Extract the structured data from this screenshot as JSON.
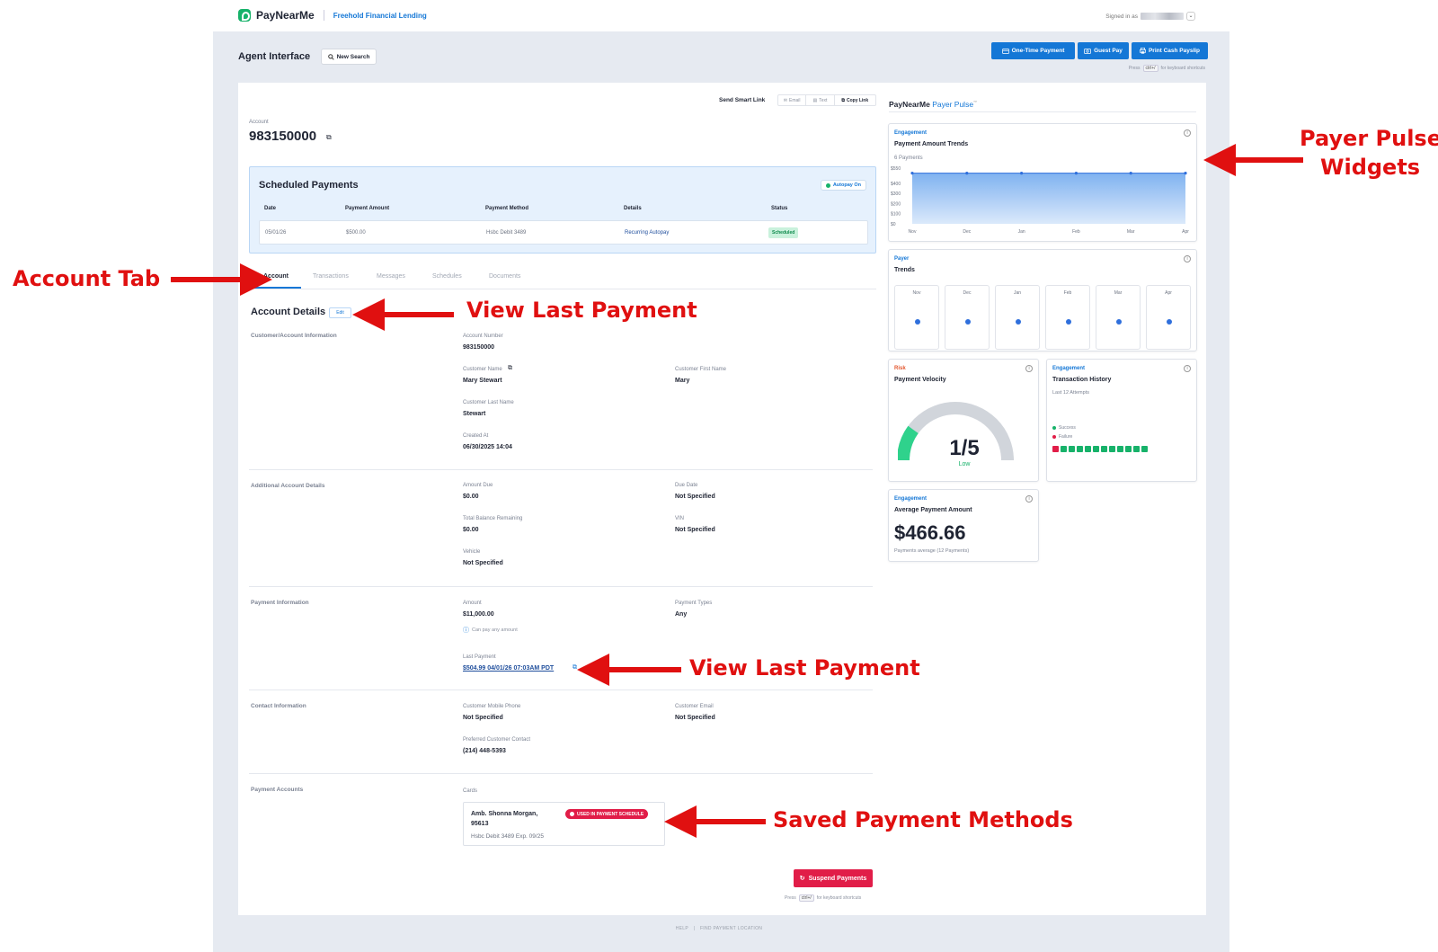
{
  "header": {
    "brand": "PayNearMe",
    "lender": "Freehold Financial Lending",
    "signed_in": "Signed in as"
  },
  "toolbar": {
    "title": "Agent Interface",
    "new_search": "New Search",
    "one_time_payment": "One-Time Payment",
    "guest_pay": "Guest Pay",
    "print_cash_payslip": "Print Cash Payslip",
    "kb_press": "Press",
    "kb_key": "ctrl+/",
    "kb_suffix": "for keyboard shortcuts"
  },
  "smart_link": {
    "label": "Send Smart Link",
    "email": "Email",
    "text": "Text",
    "copy": "Copy Link"
  },
  "account": {
    "label": "Account",
    "number": "983150000"
  },
  "scheduled": {
    "title": "Scheduled Payments",
    "autopay": "Autopay On",
    "headers": [
      "Date",
      "Payment Amount",
      "Payment Method",
      "Details",
      "Status"
    ],
    "row": {
      "date": "05/01/26",
      "amount": "$500.00",
      "method": "Hsbc Debit 3489",
      "details": "Recurring Autopay",
      "status": "Scheduled"
    }
  },
  "tabs": [
    "Account",
    "Transactions",
    "Messages",
    "Schedules",
    "Documents"
  ],
  "details": {
    "title": "Account Details",
    "edit": "Edit",
    "sections": {
      "customer": "Customer/Account Information",
      "additional": "Additional Account Details",
      "payment": "Payment Information",
      "contact": "Contact Information",
      "accounts": "Payment Accounts"
    },
    "account_number_label": "Account Number",
    "account_number": "983150000",
    "customer_name_label": "Customer Name",
    "customer_name": "Mary Stewart",
    "first_name_label": "Customer First Name",
    "first_name": "Mary",
    "last_name_label": "Customer Last Name",
    "last_name": "Stewart",
    "created_label": "Created At",
    "created": "06/30/2025 14:04",
    "amount_due_label": "Amount Due",
    "amount_due": "$0.00",
    "due_date_label": "Due Date",
    "due_date": "Not Specified",
    "balance_label": "Total Balance Remaining",
    "balance": "$0.00",
    "vin_label": "VIN",
    "vin": "Not Specified",
    "vehicle_label": "Vehicle",
    "vehicle": "Not Specified",
    "amount_label": "Amount",
    "amount": "$11,000.00",
    "any_amount": "Can pay any amount",
    "payment_types_label": "Payment Types",
    "payment_types": "Any",
    "last_payment_label": "Last Payment",
    "last_payment": "$504.99 04/01/26 07:03AM PDT",
    "mobile_label": "Customer Mobile Phone",
    "mobile": "Not Specified",
    "email_label": "Customer Email",
    "email": "Not Specified",
    "preferred_label": "Preferred Customer Contact",
    "preferred": "(214) 448-5393",
    "cards_label": "Cards",
    "card_name": "Amb. Shonna Morgan,",
    "card_zip": "95613",
    "card_meta": "Hsbc Debit 3489 Exp. 09/25",
    "card_badge": "USED IN PAYMENT SCHEDULE"
  },
  "suspend": "Suspend Payments",
  "pulse": {
    "brand": "PayNearMe",
    "product": "Payer Pulse",
    "tm": "™",
    "amount_trends": {
      "category": "Engagement",
      "title": "Payment Amount Trends",
      "subtitle": "6 Payments"
    },
    "payer_trends": {
      "category": "Payer",
      "title": "Trends",
      "months": [
        "Nov",
        "Dec",
        "Jan",
        "Feb",
        "Mar",
        "Apr"
      ]
    },
    "velocity": {
      "category": "Risk",
      "title": "Payment Velocity",
      "score": "1/5",
      "level": "Low",
      "fraction": 0.2
    },
    "history": {
      "category": "Engagement",
      "title": "Transaction History",
      "subtitle": "Last 12 Attempts",
      "success": "Success",
      "failure": "Failure",
      "attempts": [
        "failure",
        "success",
        "success",
        "success",
        "success",
        "success",
        "success",
        "success",
        "success",
        "success",
        "success",
        "success"
      ]
    },
    "average": {
      "category": "Engagement",
      "title": "Average Payment Amount",
      "value": "$466.66",
      "note": "Payments average (12 Payments)"
    }
  },
  "colors": {
    "brand_blue": "#1477d6",
    "danger": "#e11d48",
    "success": "#17b26a",
    "annotation": "#e01010"
  },
  "chart_data": {
    "type": "area",
    "categories": [
      "Nov",
      "Dec",
      "Jan",
      "Feb",
      "Mar",
      "Apr"
    ],
    "values": [
      500,
      500,
      500,
      500,
      500,
      500
    ],
    "ylim": [
      0,
      550
    ],
    "yticks": [
      "$550",
      "$400",
      "$300",
      "$200",
      "$100",
      "$0"
    ],
    "xlabel": "",
    "ylabel": ""
  },
  "annotations": {
    "account_tab": "Account Tab",
    "view_last_payment_1": "View Last Payment",
    "view_last_payment_2": "View Last Payment",
    "payer_pulse_1": "Payer Pulse",
    "payer_pulse_2": "Widgets",
    "saved_methods": "Saved Payment Methods"
  },
  "footer": {
    "help": "HELP",
    "find": "FIND PAYMENT LOCATION"
  }
}
